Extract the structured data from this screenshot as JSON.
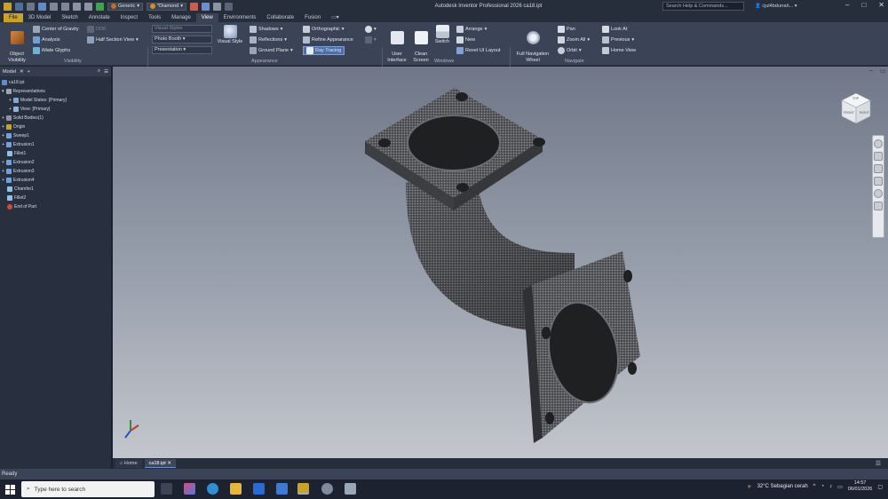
{
  "app": {
    "title": "Autodesk Inventor Professional 2026  ca18.ipt",
    "help_placeholder": "Search Help & Commands...",
    "user": "cjul4bdurrah..."
  },
  "quick_access": {
    "appearance_combo": "Generic",
    "material_combo": "*Diamond"
  },
  "tabs": [
    "File",
    "3D Model",
    "Sketch",
    "Annotate",
    "Inspect",
    "Tools",
    "Manage",
    "View",
    "Environments",
    "Collaborate",
    "Fusion"
  ],
  "active_tab": "View",
  "ribbon": {
    "visibility": {
      "label": "Visibility",
      "object_visibility": "Object\nVisibility",
      "center_of_gravity": "Center of Gravity",
      "analysis": "Analysis",
      "imate_glyphs": "iMate Glyphs",
      "half_section": "Half Section View",
      "dof": "DOF"
    },
    "appearance": {
      "label": "Appearance",
      "visual_style": "Visual Style",
      "shadows": "Shadows",
      "reflections": "Reflections",
      "ground_plane": "Ground Plane",
      "orthographic": "Orthographic",
      "refine_appearance": "Refine Appearance",
      "ray_tracing": "Ray Tracing",
      "style_combo_1": "Visual Styles",
      "style_combo_2": "Photo Booth",
      "style_combo_3": "Presentation"
    },
    "windows": {
      "label": "Windows",
      "user_interface": "User\nInterface",
      "clean_screen": "Clean\nScreen",
      "switch": "Switch",
      "arrange": "Arrange",
      "new": "New",
      "reset_ui": "Reset UI Layout"
    },
    "navigate": {
      "label": "Navigate",
      "full_nav_wheel": "Full Navigation\nWheel",
      "pan": "Pan",
      "zoom_all": "Zoom All",
      "orbit": "Orbit",
      "look_at": "Look At",
      "previous": "Previous",
      "home_view": "Home View"
    }
  },
  "browser": {
    "title": "Model",
    "items": [
      "ca18.ipt",
      "Representations",
      "Model States: [Primary]",
      "View: [Primary]",
      "Solid Bodies(1)",
      "Origin",
      "Sweep1",
      "Extrusion1",
      "Fillet1",
      "Extrusion2",
      "Extrusion3",
      "Extrusion4",
      "Chamfer1",
      "Fillet2",
      "End of Part"
    ]
  },
  "viewcube": {
    "top": "TOP",
    "front": "FRONT",
    "right": "RIGHT"
  },
  "doc_tabs": [
    "Home",
    "ca18.ipt"
  ],
  "status": "Ready",
  "taskbar": {
    "search_placeholder": "Type here to search",
    "weather": "32°C  Sebagian cerah",
    "time": "14:57",
    "date": "06/01/2026"
  },
  "colors": {
    "ribbon_bg": "#3b4456",
    "file_tab": "#c9a227",
    "viewport_top": "#6f7788",
    "viewport_bottom": "#c3c6cc"
  }
}
